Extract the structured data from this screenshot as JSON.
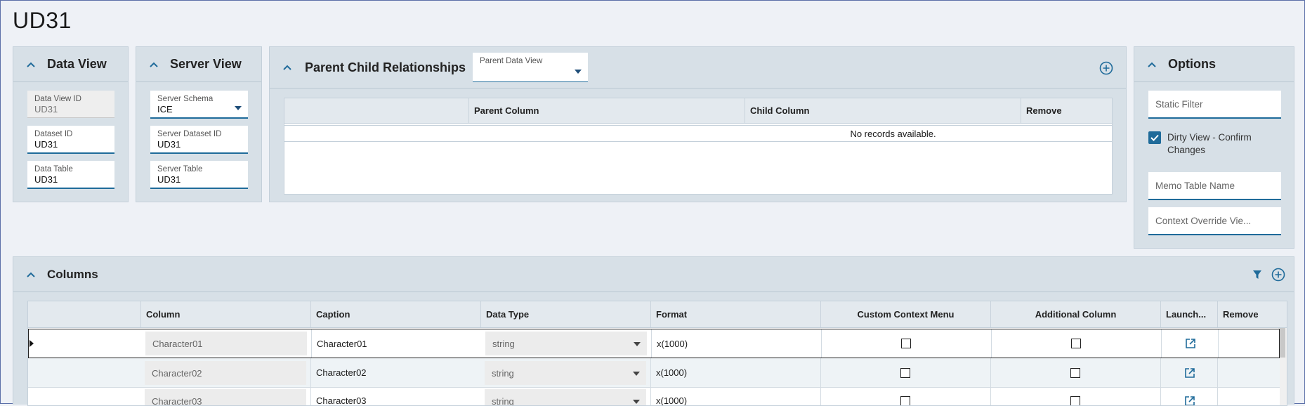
{
  "page": {
    "title": "UD31"
  },
  "data_view": {
    "title": "Data View",
    "fields": [
      {
        "label": "Data View ID",
        "value": "UD31"
      },
      {
        "label": "Dataset ID",
        "value": "UD31"
      },
      {
        "label": "Data Table",
        "value": "UD31"
      }
    ]
  },
  "server_view": {
    "title": "Server View",
    "fields": [
      {
        "label": "Server Schema",
        "value": "ICE"
      },
      {
        "label": "Server Dataset ID",
        "value": "UD31"
      },
      {
        "label": "Server Table",
        "value": "UD31"
      }
    ]
  },
  "parent_child": {
    "title": "Parent Child Relationships",
    "dropdown_label": "Parent Data View",
    "dropdown_value": "",
    "columns": [
      "",
      "Parent Column",
      "Child Column",
      "Remove"
    ],
    "empty_text": "No records available."
  },
  "options": {
    "title": "Options",
    "static_filter_placeholder": "Static Filter",
    "dirty_view_label": "Dirty View - Confirm Changes",
    "dirty_view_checked": true,
    "memo_table_placeholder": "Memo Table Name",
    "context_override_placeholder": "Context Override Vie..."
  },
  "columns_grid": {
    "title": "Columns",
    "headers": [
      "",
      "Column",
      "Caption",
      "Data Type",
      "Format",
      "Custom Context Menu",
      "Additional Column",
      "Launch...",
      "Remove"
    ],
    "rows": [
      {
        "column": "Character01",
        "caption": "Character01",
        "data_type": "string",
        "format": "x(1000)",
        "custom_context_menu": false,
        "additional_column": false,
        "selected": true
      },
      {
        "column": "Character02",
        "caption": "Character02",
        "data_type": "string",
        "format": "x(1000)",
        "custom_context_menu": false,
        "additional_column": false,
        "selected": false
      },
      {
        "column": "Character03",
        "caption": "Character03",
        "data_type": "string",
        "format": "x(1000)",
        "custom_context_menu": false,
        "additional_column": false,
        "selected": false
      }
    ]
  },
  "colors": {
    "accent": "#1f6b9a",
    "panel_bg": "#d7e0e7",
    "page_bg": "#eef1f6"
  },
  "icons": {
    "collapse": "chevron-up-icon",
    "add": "add-circle-icon",
    "filter": "filter-icon",
    "launch": "open-external-icon",
    "dropdown": "caret-down-icon"
  }
}
